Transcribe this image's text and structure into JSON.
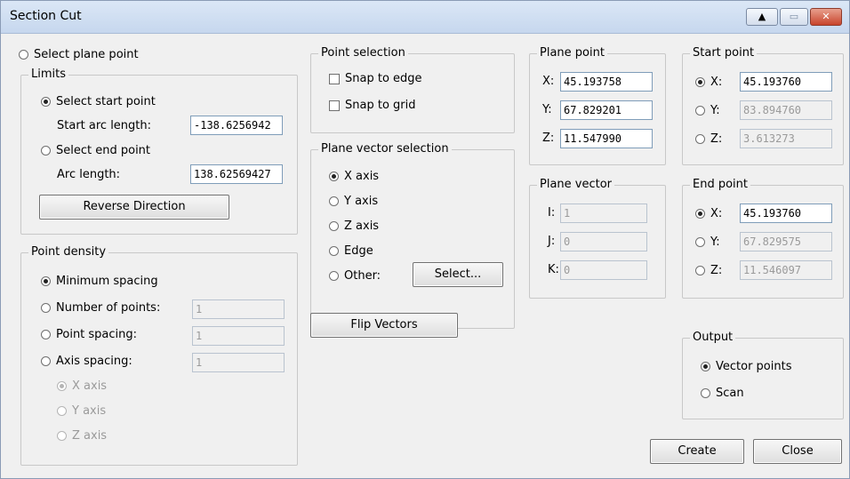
{
  "window": {
    "title": "Section Cut",
    "controls": {
      "help": "▲",
      "minimize": "▭",
      "close": "✕"
    }
  },
  "select_plane_point": "Select plane point",
  "limits": {
    "legend": "Limits",
    "select_start": "Select start point",
    "start_arc_label": "Start arc length:",
    "start_arc_value": "-138.6256942",
    "select_end": "Select end point",
    "arc_label": "Arc length:",
    "arc_value": "138.62569427",
    "reverse_btn": "Reverse Direction"
  },
  "point_density": {
    "legend": "Point density",
    "minimum_spacing": "Minimum spacing",
    "number_of_points": "Number of points:",
    "number_of_points_value": "1",
    "point_spacing": "Point spacing:",
    "point_spacing_value": "1",
    "axis_spacing": "Axis spacing:",
    "axis_spacing_value": "1",
    "x_axis": "X axis",
    "y_axis": "Y axis",
    "z_axis": "Z axis"
  },
  "point_selection": {
    "legend": "Point selection",
    "snap_edge": "Snap to edge",
    "snap_grid": "Snap to grid"
  },
  "plane_vector_selection": {
    "legend": "Plane vector selection",
    "x_axis": "X axis",
    "y_axis": "Y axis",
    "z_axis": "Z axis",
    "edge": "Edge",
    "other": "Other:",
    "select_btn": "Select..."
  },
  "flip_vectors_btn": "Flip Vectors",
  "plane_point": {
    "legend": "Plane point",
    "x_label": "X:",
    "x_value": "45.193758",
    "y_label": "Y:",
    "y_value": "67.829201",
    "z_label": "Z:",
    "z_value": "11.547990"
  },
  "plane_vector": {
    "legend": "Plane vector",
    "i_label": "I:",
    "i_value": "1",
    "j_label": "J:",
    "j_value": "0",
    "k_label": "K:",
    "k_value": "0"
  },
  "start_point": {
    "legend": "Start point",
    "x_label": "X:",
    "x_value": "45.193760",
    "y_label": "Y:",
    "y_value": "83.894760",
    "z_label": "Z:",
    "z_value": "3.613273"
  },
  "end_point": {
    "legend": "End point",
    "x_label": "X:",
    "x_value": "45.193760",
    "y_label": "Y:",
    "y_value": "67.829575",
    "z_label": "Z:",
    "z_value": "11.546097"
  },
  "output": {
    "legend": "Output",
    "vector_points": "Vector points",
    "scan": "Scan"
  },
  "create_btn": "Create",
  "close_btn": "Close"
}
